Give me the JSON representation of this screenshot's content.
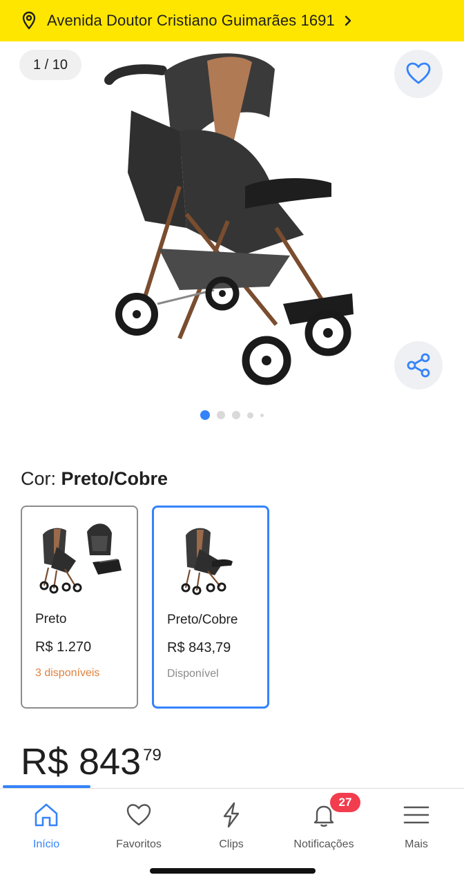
{
  "location_bar": {
    "address": "Avenida Doutor Cristiano Guimarães 1691"
  },
  "gallery": {
    "counter": "1 / 10",
    "dots": [
      {
        "active": true
      },
      {
        "active": false
      },
      {
        "active": false
      },
      {
        "active": false
      },
      {
        "active": false
      }
    ]
  },
  "color_selector": {
    "label": "Cor: ",
    "selected": "Preto/Cobre",
    "variants": [
      {
        "name": "Preto",
        "price": "R$ 1.270",
        "stock": "3 disponíveis"
      },
      {
        "name": "Preto/Cobre",
        "price": "R$ 843,79",
        "stock": "Disponível"
      }
    ]
  },
  "price": {
    "main": "R$ 843",
    "cents": "79"
  },
  "nav": {
    "items": [
      {
        "label": "Início"
      },
      {
        "label": "Favoritos"
      },
      {
        "label": "Clips"
      },
      {
        "label": "Notificações",
        "badge": "27"
      },
      {
        "label": "Mais"
      }
    ]
  },
  "colors": {
    "accent": "#3483fa",
    "brand_yellow": "#ffe600",
    "badge_red": "#f23d4f",
    "stock_orange": "#e0813d"
  }
}
